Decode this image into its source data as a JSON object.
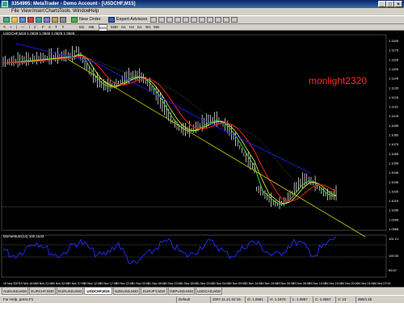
{
  "window": {
    "title": "3354995: MetaTrader - Demo Account - [USDCHF,M15]"
  },
  "menu": [
    "File",
    "View",
    "Insert",
    "Charts",
    "Tools",
    "Window",
    "Help"
  ],
  "toolbar": {
    "new_order": "New Order",
    "expert_advisors": "Expert Advisors",
    "timeframes": [
      "M1",
      "M5",
      "M15",
      "M30",
      "H1",
      "H4",
      "D1",
      "W1",
      "MN"
    ],
    "active_timeframe": "M15"
  },
  "chart": {
    "header": "USDCHF,M15  1.0925 1.0930 1.0925 1.0929",
    "watermark": "monlight2320",
    "price_labels": [
      "1.1185",
      "1.1175",
      "1.1165",
      "1.1155",
      "1.1145",
      "1.1135",
      "1.1125",
      "1.1115",
      "1.1105",
      "1.1095",
      "1.1085",
      "1.1075",
      "1.1065",
      "1.1055",
      "1.1045",
      "1.1035",
      "1.1025",
      "1.1015",
      "1.1005",
      "1.0995",
      "1.0985"
    ],
    "momentum_header": "Momentum(14) 100.1544",
    "momentum_labels": [
      "101.21",
      "100.00",
      "99.57"
    ],
    "time_labels": [
      "19 Nov 2007",
      "19 Nov 16:00",
      "19 Nov 21:00",
      "20 Nov 02:00",
      "20 Nov 07:00",
      "20 Nov 12:00",
      "20 Nov 17:00",
      "20 Nov 22:00",
      "21 Nov 03:00",
      "21 Nov 08:00",
      "21 Nov 13:00",
      "21 Nov 18:00",
      "21 Nov 23:00",
      "22 Nov 04:00",
      "22 Nov 09:00",
      "22 Nov 14:00",
      "22 Nov 19:00",
      "23 Nov 00:00",
      "23 Nov 05:00",
      "23 Nov 10:00",
      "23 Nov 15:00",
      "23 Nov 20:00",
      "24 Nov 01:00",
      "24 Nov 07:00"
    ],
    "colors": {
      "background": "#000000",
      "candle": "#ffffff",
      "ma_fast": "#40d040",
      "ma_mid": "#e0e040",
      "ma_slow": "#e02020",
      "ma_long": "#2020ff",
      "trend": "#c8c800",
      "momentum": "#2030ff"
    }
  },
  "tabs": [
    "AUDUSD,M30",
    "EURCHF,M30",
    "EURUSD,M30",
    "USDCHF,M15",
    "NZDUSD,M30",
    "EURJPY,M30",
    "GBPUSD,M30",
    "USDCAD,M30"
  ],
  "active_tab": "USDCHF,M15",
  "status": {
    "help": "For Help, press F1",
    "profile": "Default",
    "datetime": "2007.11.21 02:15",
    "open": "O: 1.0861",
    "high": "H: 1.1870",
    "low": "L: 1.0867",
    "close": "C: 1.0867",
    "volume": "V: 23",
    "traffic": "899/1 kb"
  }
}
